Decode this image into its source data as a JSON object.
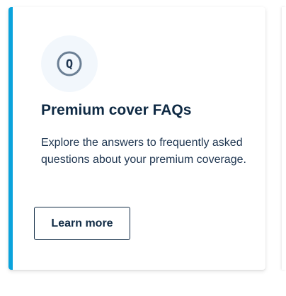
{
  "card": {
    "accent_color": "#0aa3dc",
    "icon": {
      "name": "question-q-icon",
      "glyph": "Q"
    },
    "title": "Premium cover FAQs",
    "description": "Explore the answers to frequently asked questions about your premium coverage.",
    "button_label": "Learn more"
  }
}
